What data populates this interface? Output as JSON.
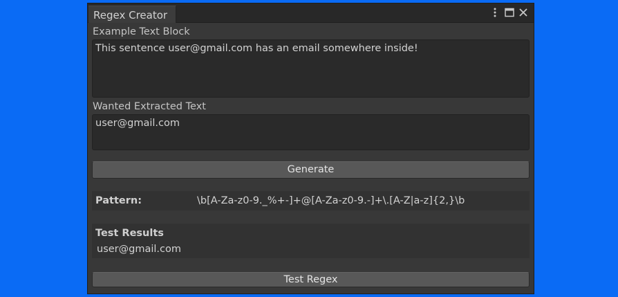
{
  "window": {
    "title": "Regex Creator",
    "controls": [
      "more-options",
      "maximize",
      "close"
    ]
  },
  "example_block": {
    "label": "Example Text Block",
    "value": "This sentence user@gmail.com has an email somewhere inside!"
  },
  "wanted_text": {
    "label": "Wanted Extracted Text",
    "value": "user@gmail.com"
  },
  "generate_button": {
    "label": "Generate"
  },
  "pattern": {
    "label": "Pattern:",
    "value": "\\b[A-Za-z0-9._%+-]+@[A-Za-z0-9.-]+\\.[A-Z|a-z]{2,}\\b"
  },
  "test_results": {
    "title": "Test Results",
    "value": "user@gmail.com"
  },
  "test_button": {
    "label": "Test Regex"
  },
  "colors": {
    "desktop": "#0a6bf5",
    "window": "#383838",
    "field": "#2a2a2a",
    "button": "#585858"
  }
}
